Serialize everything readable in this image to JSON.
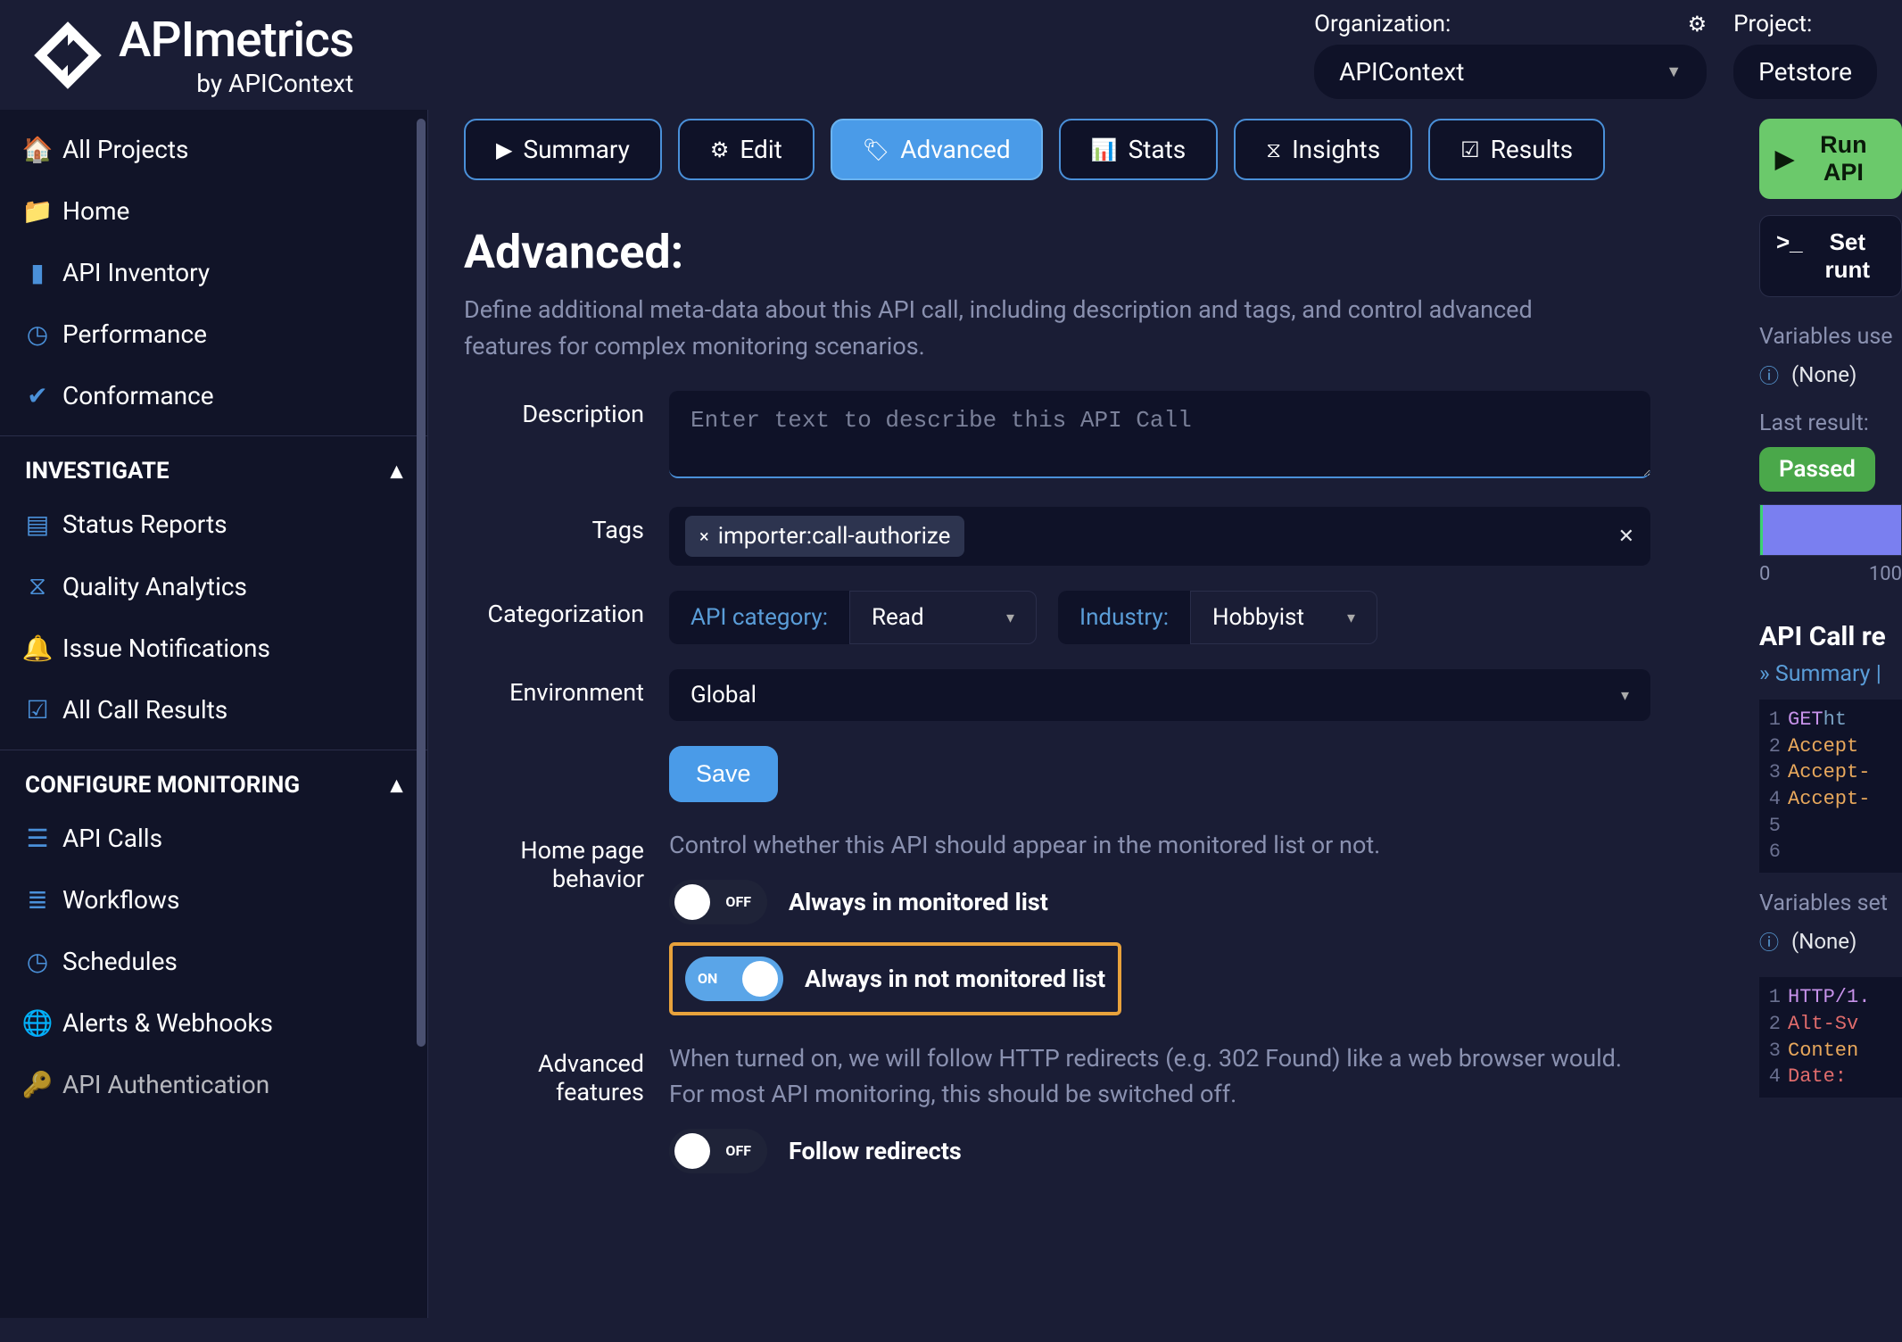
{
  "brand": {
    "title": "APImetrics",
    "subtitle": "by APIContext"
  },
  "top": {
    "org_label": "Organization:",
    "org_value": "APIContext",
    "project_label": "Project:",
    "project_value": "Petstore"
  },
  "sidebar": {
    "top": [
      {
        "icon": "home",
        "label": "All Projects"
      },
      {
        "icon": "folder",
        "label": "Home"
      },
      {
        "icon": "book",
        "label": "API Inventory"
      },
      {
        "icon": "gauge",
        "label": "Performance"
      },
      {
        "icon": "check",
        "label": "Conformance"
      }
    ],
    "investigate_header": "INVESTIGATE",
    "investigate": [
      {
        "icon": "report",
        "label": "Status Reports"
      },
      {
        "icon": "hourglass",
        "label": "Quality Analytics"
      },
      {
        "icon": "bell",
        "label": "Issue Notifications"
      },
      {
        "icon": "checkbox",
        "label": "All Call Results"
      }
    ],
    "configure_header": "CONFIGURE MONITORING",
    "configure": [
      {
        "icon": "list",
        "label": "API Calls"
      },
      {
        "icon": "stack",
        "label": "Workflows"
      },
      {
        "icon": "clock",
        "label": "Schedules"
      },
      {
        "icon": "globe",
        "label": "Alerts & Webhooks"
      },
      {
        "icon": "key",
        "label": "API Authentication"
      }
    ]
  },
  "tabs": [
    {
      "icon": "play",
      "label": "Summary"
    },
    {
      "icon": "gear",
      "label": "Edit"
    },
    {
      "icon": "tag",
      "label": "Advanced",
      "active": true
    },
    {
      "icon": "bars",
      "label": "Stats"
    },
    {
      "icon": "hourglass",
      "label": "Insights"
    },
    {
      "icon": "checkbox",
      "label": "Results"
    }
  ],
  "page": {
    "title": "Advanced:",
    "desc": "Define additional meta-data about this API call, including description and tags, and control advanced features for complex monitoring scenarios."
  },
  "form": {
    "desc_label": "Description",
    "desc_placeholder": "Enter text to describe this API Call",
    "tags_label": "Tags",
    "tag_value": "importer:call-authorize",
    "cat_label": "Categorization",
    "cat_api_label": "API category:",
    "cat_api_value": "Read",
    "cat_ind_label": "Industry:",
    "cat_ind_value": "Hobbyist",
    "env_label": "Environment",
    "env_value": "Global",
    "save_label": "Save",
    "home_label": "Home page behavior",
    "home_help": "Control whether this API should appear in the monitored list or not.",
    "toggle_monitored": "Always in monitored list",
    "toggle_not_monitored": "Always in not monitored list",
    "off_text": "OFF",
    "on_text": "ON",
    "adv_label": "Advanced features",
    "adv_help": "When turned on, we will follow HTTP redirects (e.g. 302 Found) like a web browser would. For most API monitoring, this should be switched off.",
    "toggle_redirects": "Follow redirects"
  },
  "right": {
    "run_label": "Run API",
    "runtime_label": "Set runt",
    "vars_used_label": "Variables use",
    "none": "(None)",
    "last_result_label": "Last result:",
    "passed": "Passed",
    "axis_0": "0",
    "axis_100": "100",
    "api_call_title": "API Call re",
    "summary_link": "» Summary |",
    "code1": [
      {
        "num": "1",
        "parts": [
          {
            "cls": "kw-get",
            "t": "GET "
          },
          {
            "cls": "kw-url",
            "t": "ht"
          }
        ]
      },
      {
        "num": "2",
        "parts": [
          {
            "cls": "kw-key",
            "t": "Accept"
          }
        ]
      },
      {
        "num": "3",
        "parts": [
          {
            "cls": "kw-key",
            "t": "Accept-"
          }
        ]
      },
      {
        "num": "4",
        "parts": [
          {
            "cls": "kw-key",
            "t": "Accept-"
          }
        ]
      },
      {
        "num": "5",
        "parts": []
      },
      {
        "num": "6",
        "parts": []
      }
    ],
    "vars_set_label": "Variables set",
    "code2": [
      {
        "num": "1",
        "parts": [
          {
            "cls": "kw-http",
            "t": "HTTP/1."
          }
        ]
      },
      {
        "num": "2",
        "parts": [
          {
            "cls": "kw-alt",
            "t": "Alt-Sv"
          }
        ]
      },
      {
        "num": "3",
        "parts": [
          {
            "cls": "kw-key",
            "t": "Conten"
          }
        ]
      },
      {
        "num": "4",
        "parts": [
          {
            "cls": "kw-alt",
            "t": "Date: "
          }
        ]
      }
    ]
  }
}
